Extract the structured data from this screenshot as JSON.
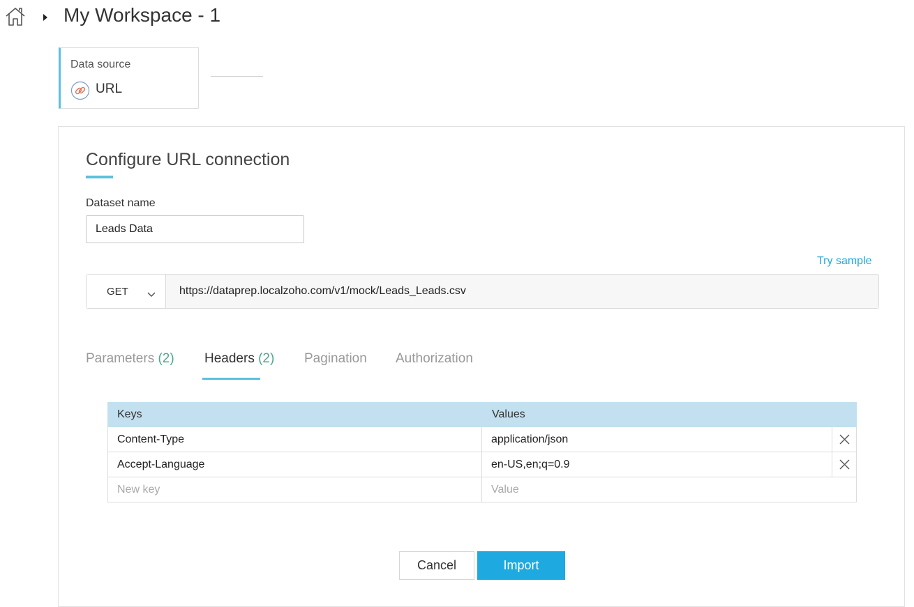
{
  "breadcrumb": {
    "home_icon": "home-icon",
    "workspace_title": "My Workspace - 1"
  },
  "data_source": {
    "label": "Data source",
    "value": "URL",
    "icon": "link-icon"
  },
  "config": {
    "title": "Configure URL connection",
    "dataset_name_label": "Dataset name",
    "dataset_name_value": "Leads Data",
    "try_sample": "Try sample",
    "method": "GET",
    "url": "https://dataprep.localzoho.com/v1/mock/Leads_Leads.csv"
  },
  "tabs": [
    {
      "label": "Parameters",
      "count": "(2)"
    },
    {
      "label": "Headers",
      "count": "(2)",
      "active": true
    },
    {
      "label": "Pagination",
      "count": ""
    },
    {
      "label": "Authorization",
      "count": ""
    }
  ],
  "headers_table": {
    "columns": [
      "Keys",
      "Values"
    ],
    "rows": [
      {
        "key": "Content-Type",
        "value": "application/json"
      },
      {
        "key": "Accept-Language",
        "value": "en-US,en;q=0.9"
      }
    ],
    "new_key_placeholder": "New key",
    "new_value_placeholder": "Value"
  },
  "actions": {
    "cancel": "Cancel",
    "import": "Import"
  },
  "colors": {
    "accent": "#1ea9e1",
    "underline": "#5bc0de",
    "header_bg": "#c2e0ef",
    "count": "#4aa88f"
  }
}
